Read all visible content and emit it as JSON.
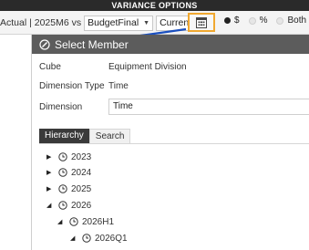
{
  "variance_options": {
    "title": "VARIANCE OPTIONS",
    "comparison_text": "Actual | 2025M6  vs",
    "scenario_select": "BudgetFinal",
    "version_select": "Current",
    "radio_dollar": "$",
    "radio_percent": "%",
    "radio_both": "Both",
    "selected_radio": "$",
    "highlight_color": "#f0a830"
  },
  "dialog": {
    "title": "Select Member",
    "cube_label": "Cube",
    "cube_value": "Equipment Division",
    "dimension_type_label": "Dimension Type",
    "dimension_type_value": "Time",
    "dimension_label": "Dimension",
    "dimension_value": "Time",
    "tabs": [
      "Hierarchy",
      "Search"
    ],
    "active_tab": "Hierarchy",
    "tree": [
      {
        "label": "2023",
        "expanded": false
      },
      {
        "label": "2024",
        "expanded": false
      },
      {
        "label": "2025",
        "expanded": false
      },
      {
        "label": "2026",
        "expanded": true
      },
      {
        "label": "2026H1",
        "expanded": true
      },
      {
        "label": "2026Q1",
        "expanded": true
      }
    ]
  }
}
